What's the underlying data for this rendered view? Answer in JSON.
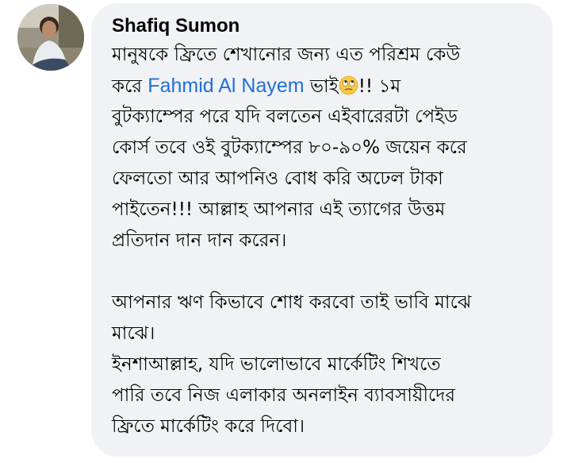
{
  "comment": {
    "author": "Shafiq Sumon",
    "line1": "মানুষকে ফ্রিতে শেখানোর জন্য এত পরিশ্রম কেউ",
    "line2_pre": "করে ",
    "mention": "Fahmid Al Nayem",
    "line2_mid": "  ভাই",
    "emoji_icon": "face-with-rolling-eyes",
    "line2_post": "!!  ১ম",
    "line3": "বুটক্যাম্পের পরে যদি বলতেন এইবারেরটা পেইড",
    "line4": "কোর্স তবে ওই বুটক্যাম্পের ৮০-৯০% জয়েন করে",
    "line5": "ফেলতো আর আপনিও বোধ করি অঢেল টাকা",
    "line6": "পাইতেন!!! আল্লাহ আপনার এই ত্যাগের উত্তম",
    "line7": "প্রতিদান দান দান করেন।",
    "line8": "আপনার ঋণ কিভাবে শোধ করবো তাই ভাবি মাঝে",
    "line9": "মাঝে।",
    "line10": "ইনশাআল্লাহ,  যদি ভালোভাবে মার্কেটিং শিখতে",
    "line11": "পারি তবে নিজ এলাকার অনলাইন ব্যাবসায়ীদের",
    "line12": "ফ্রিতে মার্কেটিং করে দিবো।"
  },
  "colors": {
    "bubble": "#f0f2f5",
    "text": "#050505",
    "mention": "#216fdb"
  }
}
